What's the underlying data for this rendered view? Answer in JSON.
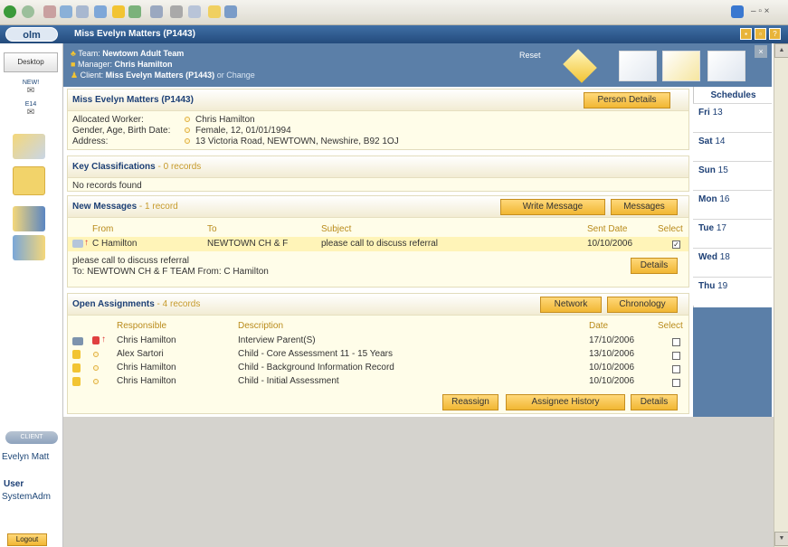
{
  "window": {
    "title": "Miss Evelyn Matters (P1443)",
    "logo": "olm"
  },
  "toolbar": {
    "icons": [
      "back-icon",
      "forward-icon",
      "stop-icon",
      "refresh-icon",
      "home-icon",
      "search-icon",
      "favorites-icon",
      "media-icon",
      "mail-icon",
      "print-icon",
      "edit-icon",
      "folder-icon",
      "window-icon"
    ]
  },
  "leftnav": {
    "desktop_label": "Desktop",
    "inbox": {
      "label": "NEW!",
      "count": "E14"
    },
    "client_logo": "CLIENT",
    "client_name": "Evelyn Matt",
    "user_label": "User",
    "user_name": "SystemAdm",
    "logout_label": "Logout"
  },
  "header": {
    "team_prefix": "Team:",
    "team": "Newtown Adult Team",
    "manager_prefix": "Manager:",
    "manager": "Chris Hamilton",
    "client_prefix": "Client:",
    "client": "Miss Evelyn Matters (P1443)",
    "client_suffix": "or Change",
    "reset_label": "Reset",
    "close_label": "×"
  },
  "person": {
    "title": "Miss Evelyn Matters (P1443)",
    "button": "Person Details",
    "fields": [
      {
        "label": "Allocated Worker:",
        "value": "Chris Hamilton"
      },
      {
        "label": "Gender, Age, Birth Date:",
        "value": "Female, 12, 01/01/1994"
      },
      {
        "label": "Address:",
        "value": "13 Victoria Road, NEWTOWN, Newshire, B92 1OJ"
      }
    ]
  },
  "classifications": {
    "title": "Key Classifications",
    "count": " - 0 records",
    "empty": "No records found"
  },
  "messages": {
    "title": "New Messages",
    "count": " - 1 record",
    "buttons": {
      "write": "Write Message",
      "messages": "Messages",
      "details": "Details"
    },
    "columns": {
      "from": "From",
      "to": "To",
      "subject": "Subject",
      "sent": "Sent Date",
      "select": "Select"
    },
    "rows": [
      {
        "from": "C Hamilton",
        "to": "NEWTOWN CH & F",
        "subject": "please call to discuss referral",
        "sent": "10/10/2006",
        "selected": true
      }
    ],
    "preview_line1": "please call to discuss referral",
    "preview_line2": "To: NEWTOWN CH & F TEAM From: C Hamilton"
  },
  "assignments": {
    "title": "Open Assignments",
    "count": " - 4 records",
    "buttons": {
      "network": "Network",
      "chronology": "Chronology",
      "reassign": "Reassign",
      "history": "Assignee History",
      "details": "Details"
    },
    "columns": {
      "responsible": "Responsible",
      "description": "Description",
      "date": "Date",
      "select": "Select"
    },
    "rows": [
      {
        "responsible": "Chris Hamilton",
        "description": "Interview Parent(S)",
        "date": "17/10/2006"
      },
      {
        "responsible": "Alex Sartori",
        "description": "Child - Core Assessment 11 - 15 Years",
        "date": "13/10/2006"
      },
      {
        "responsible": "Chris Hamilton",
        "description": "Child - Background Information Record",
        "date": "10/10/2006"
      },
      {
        "responsible": "Chris Hamilton",
        "description": "Child - Initial Assessment",
        "date": "10/10/2006"
      }
    ]
  },
  "schedules": {
    "title": "Schedules",
    "days": [
      {
        "day": "Fri",
        "date": "13"
      },
      {
        "day": "Sat",
        "date": "14"
      },
      {
        "day": "Sun",
        "date": "15"
      },
      {
        "day": "Mon",
        "date": "16"
      },
      {
        "day": "Tue",
        "date": "17"
      },
      {
        "day": "Wed",
        "date": "18"
      },
      {
        "day": "Thu",
        "date": "19"
      }
    ]
  },
  "colors": {
    "accent": "#5b7fa8",
    "button": "#f1b733",
    "panel": "#fffde9",
    "title": "#1c3f75"
  }
}
